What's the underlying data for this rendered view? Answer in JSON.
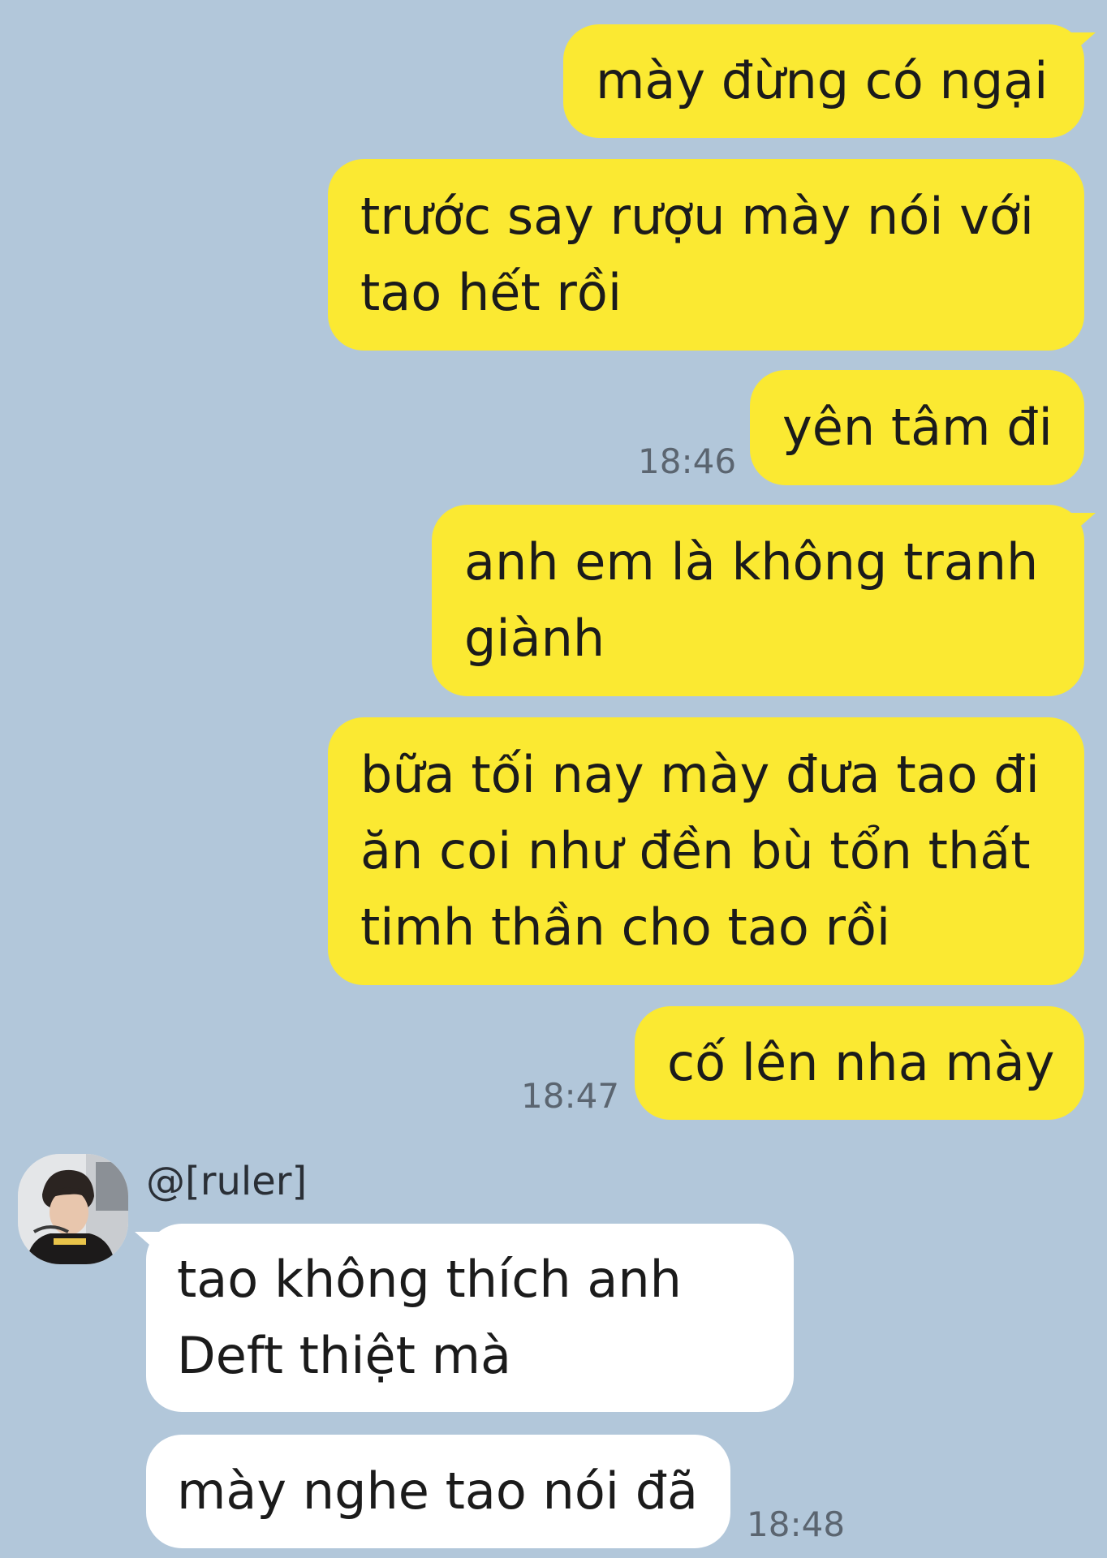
{
  "messages_out": [
    {
      "lines": [
        "mày đừng có ngại"
      ]
    },
    {
      "lines": [
        "trước say rượu mày nói với",
        "tao hết rồi"
      ]
    },
    {
      "lines": [
        "yên tâm đi"
      ],
      "time": "18:46"
    },
    {
      "lines": [
        "anh em là không tranh",
        "giành"
      ]
    },
    {
      "lines": [
        "bữa tối nay mày đưa tao đi",
        "ăn coi như đền bù tổn thất",
        "timh thần cho tao rồi"
      ]
    },
    {
      "lines": [
        "cố lên nha mày"
      ],
      "time": "18:47"
    }
  ],
  "incoming": {
    "sender": "@[ruler]",
    "avatar_icon": "profile-photo",
    "messages": [
      {
        "lines": [
          "tao không thích anh",
          "Deft thiệt mà"
        ]
      },
      {
        "lines": [
          "mày nghe tao nói đã"
        ],
        "time": "18:48"
      }
    ]
  },
  "colors": {
    "background": "#b2c7da",
    "outgoing_bubble": "#fbe932",
    "incoming_bubble": "#ffffff"
  }
}
